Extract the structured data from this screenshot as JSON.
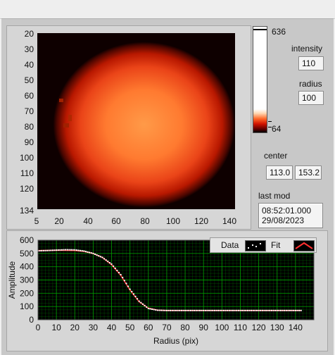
{
  "image_display": {
    "y_ticks": [
      "20",
      "30",
      "40",
      "50",
      "60",
      "70",
      "80",
      "90",
      "100",
      "110",
      "120",
      "134"
    ],
    "x_ticks": [
      "5",
      "20",
      "40",
      "60",
      "80",
      "100",
      "120",
      "140"
    ]
  },
  "color_ramp": {
    "max_label": "636",
    "min_label": "64"
  },
  "intensity": {
    "label": "intensity",
    "value": "110"
  },
  "radius": {
    "label": "radius",
    "value": "100"
  },
  "center": {
    "label": "center",
    "x": "113.0",
    "y": "153.2"
  },
  "last_mod": {
    "label": "last mod",
    "time": "08:52:01.000",
    "date": "29/08/2023"
  },
  "legend": {
    "data_label": "Data",
    "fit_label": "Fit"
  },
  "colors": {
    "fit_line": "#ff3030",
    "data_points": "#ffffff",
    "plot_bg": "#000000",
    "grid": "#00a000"
  },
  "chart_data": {
    "type": "scatter",
    "title": "",
    "xlabel": "Radius (pix)",
    "ylabel": "Amplitude",
    "xlim": [
      0,
      150
    ],
    "ylim": [
      0,
      600
    ],
    "x_ticks": [
      0,
      10,
      20,
      30,
      40,
      50,
      60,
      70,
      80,
      90,
      100,
      110,
      120,
      130,
      140
    ],
    "y_ticks": [
      0,
      100,
      200,
      300,
      400,
      500,
      600
    ],
    "series": [
      {
        "name": "Data",
        "x": [
          0,
          5,
          10,
          15,
          20,
          25,
          30,
          35,
          40,
          45,
          50,
          55,
          60,
          65,
          70,
          75,
          80,
          90,
          100,
          110,
          120,
          130,
          140,
          143
        ],
        "y": [
          520,
          522,
          525,
          528,
          527,
          518,
          500,
          470,
          420,
          340,
          230,
          140,
          85,
          72,
          70,
          70,
          70,
          70,
          70,
          70,
          70,
          70,
          70,
          70
        ]
      },
      {
        "name": "Fit",
        "x": [
          0,
          10,
          20,
          25,
          30,
          35,
          40,
          45,
          50,
          55,
          60,
          65,
          70,
          80,
          100,
          120,
          143
        ],
        "y": [
          522,
          524,
          522,
          515,
          500,
          470,
          415,
          335,
          225,
          135,
          88,
          73,
          70,
          70,
          70,
          70,
          70
        ]
      }
    ],
    "grid": true,
    "legend_position": "top-right"
  }
}
